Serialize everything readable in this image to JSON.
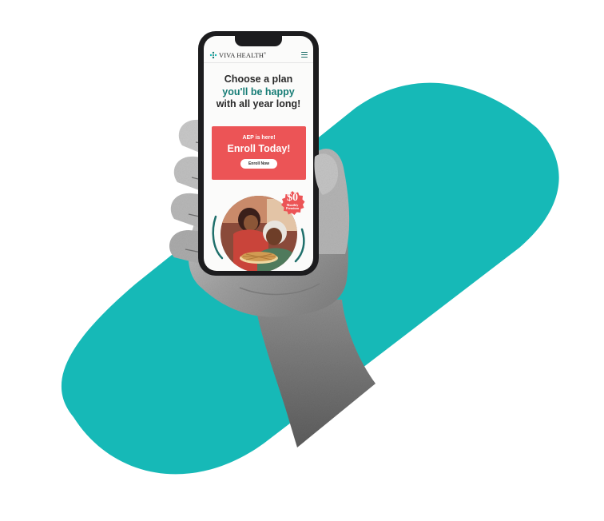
{
  "brand": {
    "name": "VIVA HEALTH",
    "trademark": "®"
  },
  "headline": {
    "line1": "Choose a plan",
    "line2": "you'll be happy",
    "line3": "with all year long!"
  },
  "promo": {
    "eyebrow": "AEP is here!",
    "title": "Enroll Today!",
    "button_label": "Enroll Now"
  },
  "badge": {
    "amount": "$0",
    "line1": "Monthly",
    "line2": "Premium"
  },
  "colors": {
    "teal": "#16b9b7",
    "accent": "#177d76",
    "promo_red": "#ec5456"
  },
  "icons": [
    "menu-icon",
    "logo-mark-icon"
  ]
}
